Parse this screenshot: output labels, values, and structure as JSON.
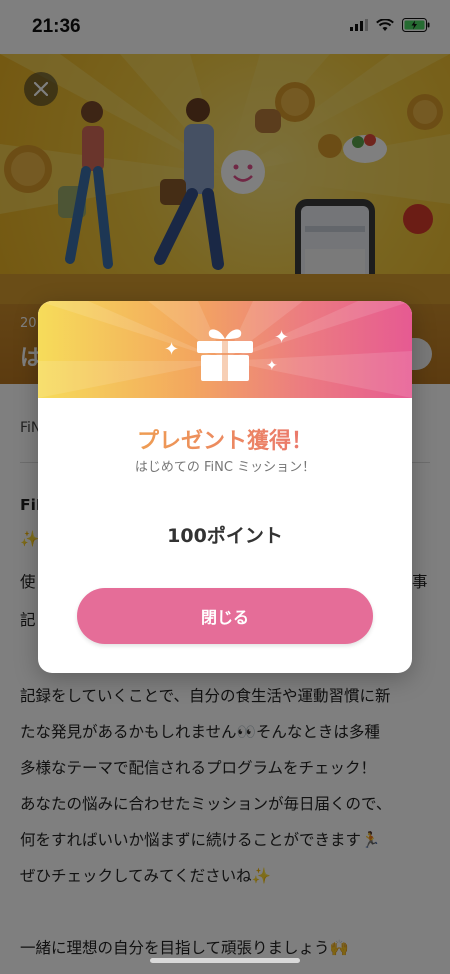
{
  "status_bar": {
    "time": "21:36"
  },
  "article": {
    "date_stub": "20",
    "title_stub": "は",
    "meta_stub": "FiN",
    "body_lines": [
      "FiN",
      "✨",
      "使",
      "記",
      "",
      "記録をしていくことで、自分の食生活や運動習慣に新",
      "たな発見があるかもしれません👀そんなときは多種",
      "多様なテーマで配信されるプログラムをチェック！",
      "あなたの悩みに合わせたミッションが毎日届くので、",
      "何をすればいいか悩まずに続けることができます🏃",
      "ぜひチェックしてみてくださいね✨",
      "",
      "一緒に理想の自分を目指して頑張りましょう🙌"
    ],
    "side_fragments": [
      "事"
    ]
  },
  "modal": {
    "title": "プレゼント獲得！",
    "subtitle": "はじめての FiNC ミッション！",
    "points": "100ポイント",
    "close_label": "閉じる"
  },
  "colors": {
    "button": "#e56d98",
    "header_gradient_start": "#f6dc5a",
    "header_gradient_end": "#e65a92"
  },
  "icons": [
    "close-icon",
    "wifi-icon",
    "battery-charging-icon",
    "signal-icon",
    "gift-icon",
    "sparkle-icon"
  ]
}
